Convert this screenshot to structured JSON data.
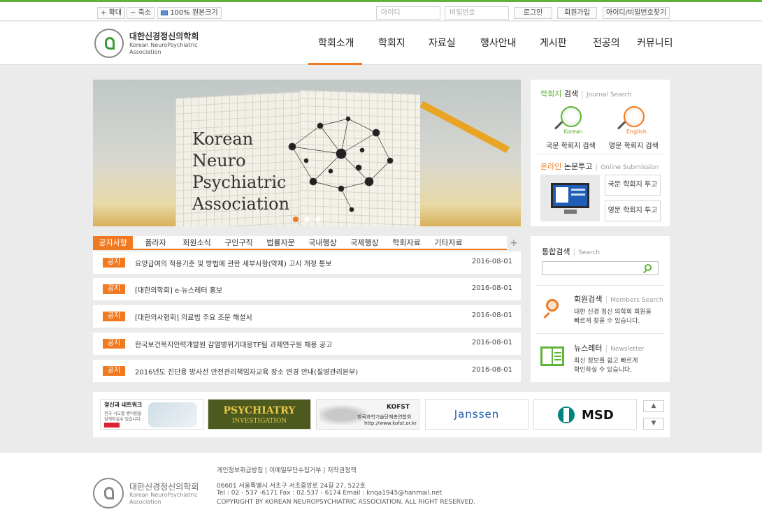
{
  "topbar": {
    "zoom_in": "확대",
    "zoom_out": "축소",
    "original_size": "100% 원본크기",
    "id_placeholder": "아이디",
    "pw_placeholder": "비밀번호",
    "login": "로그인",
    "join": "회원가입",
    "find": "아이디/비밀번호찾기"
  },
  "logo": {
    "name_ko": "대한신경정신의학회",
    "name_en1": "Korean NeuroPsychiatric",
    "name_en2": "Association"
  },
  "nav": [
    "학회소개",
    "학회지",
    "자료실",
    "행사안내",
    "게시판",
    "전공의",
    "커뮤니티"
  ],
  "hero": {
    "title": "Korean\nNeuro\nPsychiatric\nAssociation"
  },
  "journal": {
    "title_a": "학회지",
    "title_b": "검색",
    "sub": "Journal Search",
    "korean_word": "Korean",
    "english_word": "English",
    "korean_label": "국문 학회지 검색",
    "english_label": "영문 학회지 검색"
  },
  "submission": {
    "title_a": "온라인",
    "title_b": "논문투고",
    "sub": "Online Submission",
    "korean_btn": "국문 학회지 투고",
    "english_btn": "영문 학회지 투고"
  },
  "tabs": [
    "공지사항",
    "플라자",
    "회원소식",
    "구인구직",
    "법률자문",
    "국내행상",
    "국제행상",
    "학회자료",
    "기타자료"
  ],
  "more": "+",
  "notices": [
    {
      "badge": "공지",
      "title": "요양급여의 적용기준 및 방법에 관한 세부사항(약제) 고시 개정 통보",
      "date": "2016-08-01"
    },
    {
      "badge": "공지",
      "title": "[대한의학회] e-뉴스레터 홍보",
      "date": "2016-08-01"
    },
    {
      "badge": "공지",
      "title": "[대한의사협회] 의료법 주요 조문 해설서",
      "date": "2016-08-01"
    },
    {
      "badge": "공지",
      "title": "한국보건복지인력개발원 감염병위기대응TF팀 과제연구원 채용 공고",
      "date": "2016-08-01"
    },
    {
      "badge": "공지",
      "title": "2016년도 진단용 방사선 안전관리책임자교육 장소 변경 안내(질병관리본부)",
      "date": "2016-08-01"
    }
  ],
  "search": {
    "title": "통합검색",
    "sub": "Search"
  },
  "members": {
    "title": "회원검색",
    "sub": "Members Search",
    "desc1": "대한 신경 정신 의학회 회원을",
    "desc2": "빠르게 찾을 수 있습니다."
  },
  "newsletter": {
    "title": "뉴스레터",
    "sub": "Newsletter",
    "desc1": "최신 정보를 쉽고 빠르게",
    "desc2": "확인하실 수 있습니다."
  },
  "banners": {
    "b1_title": "정신과 네트워크",
    "b1_line1": "전국 시도별 병의원을",
    "b1_line2": "검색하실수 있습니다.",
    "b2_title": "PSYCHIATRY",
    "b2_sub": "INVESTIGATION",
    "b3_title": "KOFST",
    "b3_line1": "한국과학기술단체총연합회",
    "b3_line2": "http://www.kofst.or.kr",
    "b4_title": "Janssen",
    "b5_title": "MSD"
  },
  "footer": {
    "links": "개인정보취급방침 | 이메일무단수집거부 | 저작권정책",
    "address": "06601 서울특별시 서초구 서초중앙로 24길 27, 522호",
    "contact": "Tel : 02 - 537 -6171 Fax : 02.537 - 6174 Email : knqa1945@hanmail.net",
    "copyright": "COPYRIGHT BY KOREAN NEUROPSYCHIATRIC ASSOCIATION. ALL RIGHT RESERVED."
  },
  "colors": {
    "accent": "#f07a22",
    "green": "#5fb336"
  }
}
